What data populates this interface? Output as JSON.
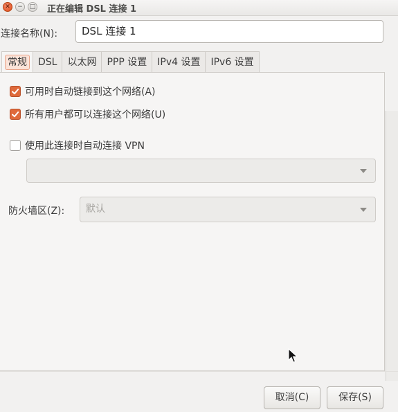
{
  "window": {
    "title": "正在编辑 DSL 连接 1"
  },
  "connection": {
    "label": "连接名称(N):",
    "value": "DSL 连接 1"
  },
  "tabs": [
    {
      "label": "常规"
    },
    {
      "label": "DSL"
    },
    {
      "label": "以太网"
    },
    {
      "label": "PPP 设置"
    },
    {
      "label": "IPv4 设置"
    },
    {
      "label": "IPv6 设置"
    }
  ],
  "general": {
    "auto_connect": {
      "label": "可用时自动链接到这个网络(A)",
      "checked": true
    },
    "all_users": {
      "label": "所有用户都可以连接这个网络(U)",
      "checked": true
    },
    "vpn": {
      "label": "使用此连接时自动连接 VPN",
      "checked": false,
      "selected": ""
    },
    "firewall": {
      "label": "防火墙区(Z):",
      "selected": "默认"
    }
  },
  "buttons": {
    "cancel": "取消(C)",
    "save": "保存(S)"
  },
  "colors": {
    "accent": "#df6a3b",
    "background": "#f2f1f0"
  }
}
